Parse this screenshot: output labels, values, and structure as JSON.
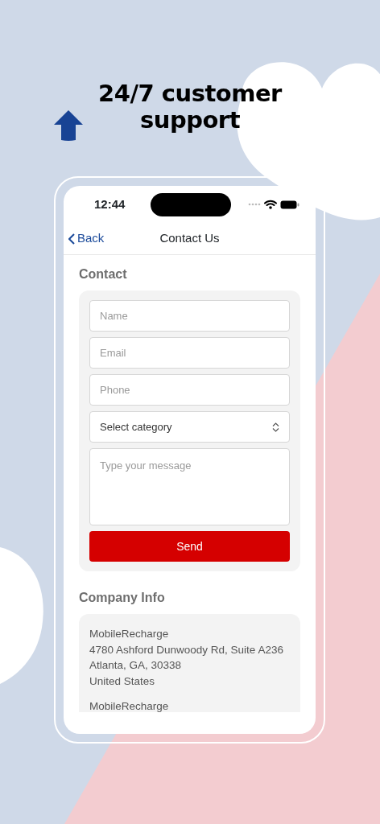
{
  "headline": "24/7 customer support",
  "status_bar": {
    "time": "12:44"
  },
  "nav": {
    "back": "Back",
    "title": "Contact Us"
  },
  "contact": {
    "heading": "Contact",
    "fields": [
      {
        "kind": "input",
        "placeholder": "Name"
      },
      {
        "kind": "input",
        "placeholder": "Email"
      },
      {
        "kind": "input",
        "placeholder": "Phone"
      },
      {
        "kind": "select",
        "value": "Select category"
      },
      {
        "kind": "textarea",
        "placeholder": "Type your message"
      }
    ],
    "button": "Send"
  },
  "company": {
    "heading": "Company Info",
    "blocks": [
      {
        "lines": [
          "MobileRecharge",
          "4780 Ashford Dunwoody Rd, Suite A236",
          "Atlanta, GA, 30338",
          "United States"
        ]
      },
      {
        "lines": [
          "MobileRecharge"
        ]
      }
    ]
  }
}
